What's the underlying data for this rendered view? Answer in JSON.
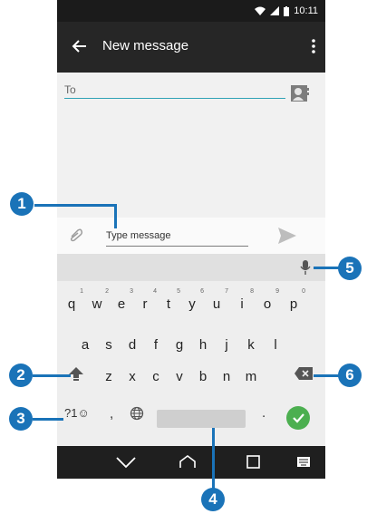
{
  "status_bar": {
    "time": "10:11"
  },
  "app_bar": {
    "title": "New message",
    "back_icon": "arrow-left-icon",
    "menu_icon": "overflow-menu-icon"
  },
  "recipient": {
    "label": "To",
    "contact_icon": "contact-card-icon"
  },
  "composer": {
    "placeholder": "Type message",
    "attach_icon": "paperclip-icon",
    "send_icon": "send-icon"
  },
  "keyboard": {
    "row1": [
      {
        "key": "q",
        "hint": "1"
      },
      {
        "key": "w",
        "hint": "2"
      },
      {
        "key": "e",
        "hint": "3"
      },
      {
        "key": "r",
        "hint": "4"
      },
      {
        "key": "t",
        "hint": "5"
      },
      {
        "key": "y",
        "hint": "6"
      },
      {
        "key": "u",
        "hint": "7"
      },
      {
        "key": "i",
        "hint": "8"
      },
      {
        "key": "o",
        "hint": "9"
      },
      {
        "key": "p",
        "hint": "0"
      }
    ],
    "row2": [
      "a",
      "s",
      "d",
      "f",
      "g",
      "h",
      "j",
      "k",
      "l"
    ],
    "row3": [
      "z",
      "x",
      "c",
      "v",
      "b",
      "n",
      "m"
    ],
    "symbols_key": "?1☺",
    "comma": ",",
    "period": ".",
    "mic_icon": "microphone-icon",
    "shift_icon": "shift-icon",
    "backspace_icon": "backspace-icon",
    "globe_icon": "globe-icon",
    "enter_icon": "checkmark-icon"
  },
  "nav_bar": {
    "back_icon": "chevron-down-icon",
    "home_icon": "home-icon",
    "recents_icon": "square-icon",
    "keyboard_icon": "keyboard-icon"
  },
  "callouts": [
    "1",
    "2",
    "3",
    "4",
    "5",
    "6"
  ],
  "colors": {
    "accent": "#30a3b6",
    "callout": "#1a73b8",
    "enter": "#4caf50"
  }
}
